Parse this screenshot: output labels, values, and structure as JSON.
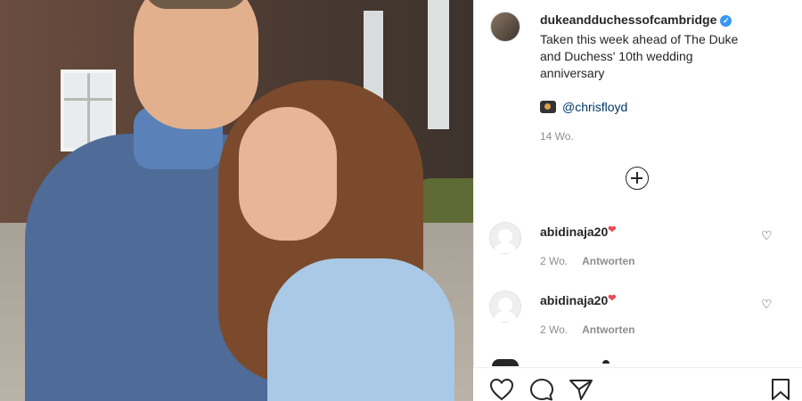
{
  "post": {
    "author": "dukeandduchessofcambridge",
    "verified_icon": "verified-badge-icon",
    "caption": "Taken this week ahead of The Duke and Duchess' 10th wedding anniversary",
    "credit_icon": "camera-emoji",
    "credit_handle": "@chrisfloyd",
    "time": "14 Wo."
  },
  "load_more_icon": "plus-circle-icon",
  "comments": [
    {
      "user": "abidinaja20",
      "emoji": "❤",
      "time": "2 Wo.",
      "reply_label": "Antworten"
    },
    {
      "user": "abidinaja20",
      "emoji": "❤",
      "time": "2 Wo.",
      "reply_label": "Antworten"
    }
  ],
  "actions": {
    "like_icon": "heart-icon",
    "comment_icon": "comment-icon",
    "share_icon": "paper-plane-icon",
    "save_icon": "bookmark-icon"
  },
  "colors": {
    "link": "#00376b",
    "secondary_text": "#8e8e8e",
    "verified": "#3897f0"
  }
}
